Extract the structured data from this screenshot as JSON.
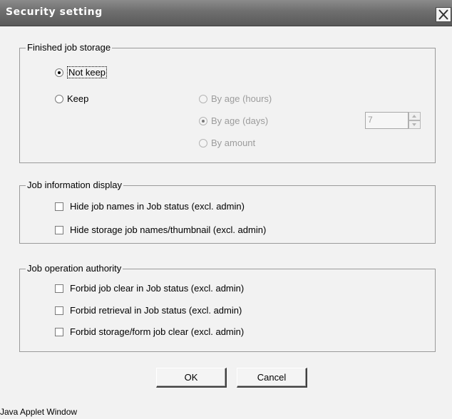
{
  "window": {
    "title": "Security setting",
    "status_text": "Java Applet Window"
  },
  "finished_job_storage": {
    "legend": "Finished job storage",
    "not_keep_label": "Not keep",
    "keep_label": "Keep",
    "selected": "Not keep",
    "by_age_hours_label": "By age (hours)",
    "by_age_days_label": "By age (days)",
    "by_amount_label": "By amount",
    "sub_selected": "By age (days)",
    "spinner_value": "7"
  },
  "job_information_display": {
    "legend": "Job information display",
    "items": [
      {
        "label": "Hide job names in Job status (excl. admin)",
        "checked": false
      },
      {
        "label": "Hide storage job names/thumbnail (excl. admin)",
        "checked": false
      }
    ]
  },
  "job_operation_authority": {
    "legend": "Job operation authority",
    "items": [
      {
        "label": "Forbid job clear in Job status (excl. admin)",
        "checked": false
      },
      {
        "label": "Forbid retrieval in Job status (excl. admin)",
        "checked": false
      },
      {
        "label": "Forbid storage/form job clear (excl. admin)",
        "checked": false
      }
    ]
  },
  "buttons": {
    "ok_label": "OK",
    "cancel_label": "Cancel"
  },
  "icons": {
    "close": "close-icon"
  },
  "colors": {
    "titlebar": "#6e6e6e",
    "dialog_background": "#f2f2f2",
    "disabled_text": "#9c9c9c"
  }
}
